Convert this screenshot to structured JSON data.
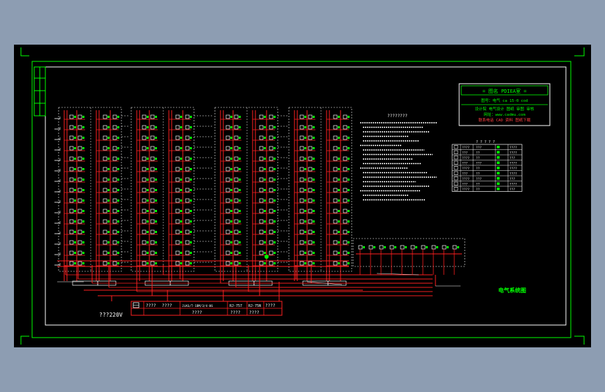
{
  "colors": {
    "background": "#8d9db2",
    "canvas": "#000000",
    "frame": "#00ff00",
    "wire": "#ff2020",
    "annotation": "#ffffff",
    "accent": "#00ff00",
    "warning": "#ff4040"
  },
  "title_block": {
    "line1": "= 图名 PDIEA室 =",
    "line2": "图号：电气  ca 15-0 cod",
    "line3": "设计院 电气设计 图纸 审图 审核",
    "line4": "网址：www.cadmu.com",
    "line5": "联系电话 CAD 资料 图纸下载"
  },
  "notes": {
    "heading": "????????"
  },
  "legend": {
    "heading": "? ? ? ? ?",
    "rows": [
      [
        "????",
        "???",
        "????"
      ],
      [
        "???",
        "??",
        "????"
      ],
      [
        "????",
        "??",
        "???"
      ],
      [
        "???",
        "???",
        "????"
      ],
      [
        "????",
        "??",
        "????"
      ],
      [
        "???",
        "??",
        "????"
      ],
      [
        "????",
        "???",
        "???"
      ],
      [
        "???",
        "??",
        "????"
      ],
      [
        "????",
        "??",
        "???"
      ]
    ]
  },
  "bottom_table": {
    "cells": [
      "????",
      "????",
      "JLKG/T-1BM/3/4-06",
      "????",
      "RJ-757",
      "????",
      "RJ-75N",
      "????",
      "????"
    ],
    "caption": "???220V"
  },
  "drawing_label": "电气系统图"
}
